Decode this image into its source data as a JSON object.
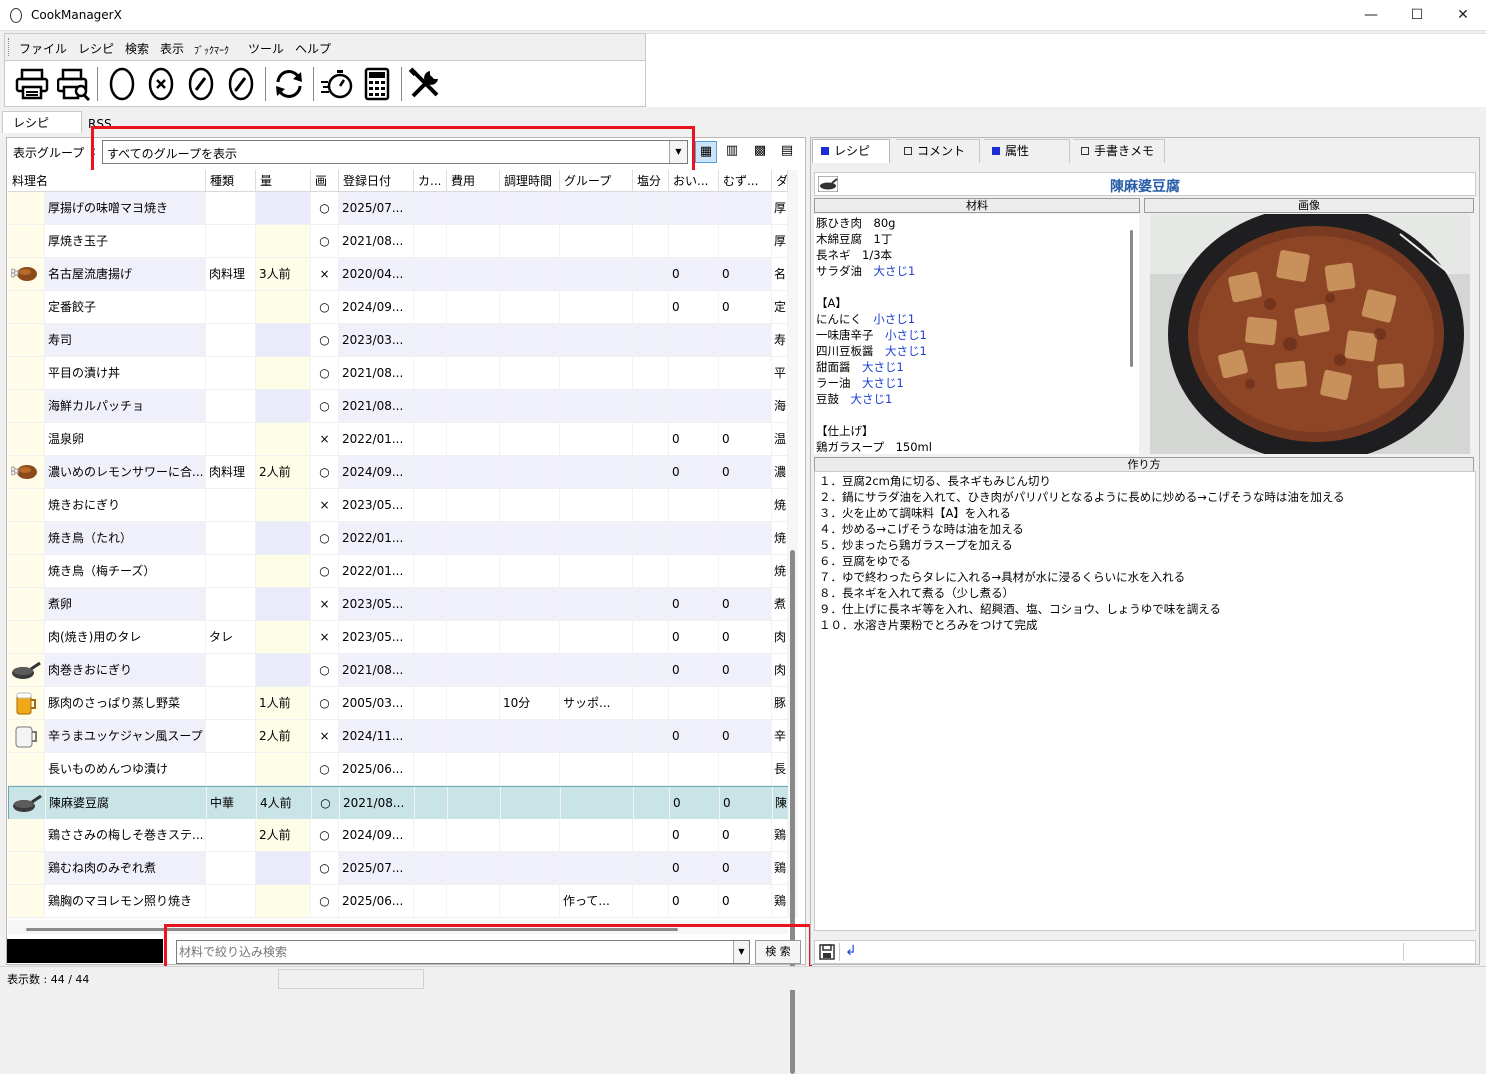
{
  "window": {
    "title": "CookManagerX",
    "minimize": "—",
    "maximize": "☐",
    "close": "✕"
  },
  "menu": [
    "ファイル",
    "レシピ",
    "検索",
    "表示",
    "ﾌﾞｯｸﾏｰｸ",
    "ツール",
    "ヘルプ"
  ],
  "toolbar": [
    "print-icon",
    "print-preview-icon",
    "new-recipe-icon",
    "delete-recipe-icon",
    "edit-recipe-icon",
    "edit-alt-icon",
    "refresh-icon",
    "timer-icon",
    "calculator-icon",
    "tools-icon"
  ],
  "pane_tabs": [
    "レシピ",
    "RSS"
  ],
  "group": {
    "label": "表示グループ",
    "value": "すべてのグループを表示"
  },
  "columns": [
    "料理名",
    "種類",
    "量",
    "画",
    "登録日付",
    "カ...",
    "費用",
    "調理時間",
    "グループ",
    "塩分",
    "おい...",
    "むず...",
    "ダ"
  ],
  "rows": [
    {
      "icon": "",
      "name": "厚揚げの味噌マヨ焼き",
      "cat": "",
      "amt": "",
      "img": "○",
      "date": "2025/07...",
      "time": "",
      "group": "",
      "o": "",
      "m": "",
      "f": "厚"
    },
    {
      "icon": "",
      "name": "厚焼き玉子",
      "cat": "",
      "amt": "",
      "img": "○",
      "date": "2021/08...",
      "time": "",
      "group": "",
      "o": "",
      "m": "",
      "f": "厚"
    },
    {
      "icon": "chicken-leg-icon",
      "name": "名古屋流唐揚げ",
      "cat": "肉料理",
      "amt": "3人前",
      "img": "×",
      "date": "2020/04...",
      "time": "",
      "group": "",
      "o": "0",
      "m": "0",
      "f": "名"
    },
    {
      "icon": "",
      "name": "定番餃子",
      "cat": "",
      "amt": "",
      "img": "○",
      "date": "2024/09...",
      "time": "",
      "group": "",
      "o": "0",
      "m": "0",
      "f": "定"
    },
    {
      "icon": "",
      "name": "寿司",
      "cat": "",
      "amt": "",
      "img": "○",
      "date": "2023/03...",
      "time": "",
      "group": "",
      "o": "",
      "m": "",
      "f": "寿"
    },
    {
      "icon": "",
      "name": "平目の漬け丼",
      "cat": "",
      "amt": "",
      "img": "○",
      "date": "2021/08...",
      "time": "",
      "group": "",
      "o": "",
      "m": "",
      "f": "平"
    },
    {
      "icon": "",
      "name": "海鮮カルパッチョ",
      "cat": "",
      "amt": "",
      "img": "○",
      "date": "2021/08...",
      "time": "",
      "group": "",
      "o": "",
      "m": "",
      "f": "海"
    },
    {
      "icon": "",
      "name": "温泉卵",
      "cat": "",
      "amt": "",
      "img": "×",
      "date": "2022/01...",
      "time": "",
      "group": "",
      "o": "0",
      "m": "0",
      "f": "温"
    },
    {
      "icon": "chicken-leg-icon",
      "name": "濃いめのレモンサワーに合...",
      "cat": "肉料理",
      "amt": "2人前",
      "img": "○",
      "date": "2024/09...",
      "time": "",
      "group": "",
      "o": "0",
      "m": "0",
      "f": "濃"
    },
    {
      "icon": "",
      "name": "焼きおにぎり",
      "cat": "",
      "amt": "",
      "img": "×",
      "date": "2023/05...",
      "time": "",
      "group": "",
      "o": "",
      "m": "",
      "f": "焼"
    },
    {
      "icon": "",
      "name": "焼き鳥（たれ）",
      "cat": "",
      "amt": "",
      "img": "○",
      "date": "2022/01...",
      "time": "",
      "group": "",
      "o": "",
      "m": "",
      "f": "焼"
    },
    {
      "icon": "",
      "name": "焼き鳥（梅チーズ）",
      "cat": "",
      "amt": "",
      "img": "○",
      "date": "2022/01...",
      "time": "",
      "group": "",
      "o": "",
      "m": "",
      "f": "焼"
    },
    {
      "icon": "",
      "name": "煮卵",
      "cat": "",
      "amt": "",
      "img": "×",
      "date": "2023/05...",
      "time": "",
      "group": "",
      "o": "0",
      "m": "0",
      "f": "煮"
    },
    {
      "icon": "",
      "name": "肉(焼き)用のタレ",
      "cat": "タレ",
      "amt": "",
      "img": "×",
      "date": "2023/05...",
      "time": "",
      "group": "",
      "o": "0",
      "m": "0",
      "f": "肉"
    },
    {
      "icon": "frying-pan-icon",
      "name": "肉巻きおにぎり",
      "cat": "",
      "amt": "",
      "img": "○",
      "date": "2021/08...",
      "time": "",
      "group": "",
      "o": "0",
      "m": "0",
      "f": "肉"
    },
    {
      "icon": "beer-mug-icon",
      "name": "豚肉のさっぱり蒸し野菜",
      "cat": "",
      "amt": "1人前",
      "img": "○",
      "date": "2005/03...",
      "time": "10分",
      "group": "サッポ...",
      "o": "",
      "m": "",
      "f": "豚"
    },
    {
      "icon": "mug-icon",
      "name": "辛うまユッケジャン風スープ",
      "cat": "",
      "amt": "2人前",
      "img": "×",
      "date": "2024/11...",
      "time": "",
      "group": "",
      "o": "0",
      "m": "0",
      "f": "辛"
    },
    {
      "icon": "",
      "name": "長いものめんつゆ漬け",
      "cat": "",
      "amt": "",
      "img": "○",
      "date": "2025/06...",
      "time": "",
      "group": "",
      "o": "",
      "m": "",
      "f": "長"
    },
    {
      "icon": "frying-pan-icon",
      "name": "陳麻婆豆腐",
      "cat": "中華",
      "amt": "4人前",
      "img": "○",
      "date": "2021/08...",
      "time": "",
      "group": "",
      "o": "0",
      "m": "0",
      "f": "陳",
      "selected": true
    },
    {
      "icon": "",
      "name": "鶏ささみの梅しそ巻きステ...",
      "cat": "",
      "amt": "2人前",
      "img": "○",
      "date": "2024/09...",
      "time": "",
      "group": "",
      "o": "0",
      "m": "0",
      "f": "鶏"
    },
    {
      "icon": "",
      "name": "鶏むね肉のみぞれ煮",
      "cat": "",
      "amt": "",
      "img": "○",
      "date": "2025/07...",
      "time": "",
      "group": "",
      "o": "0",
      "m": "0",
      "f": "鶏"
    },
    {
      "icon": "",
      "name": "鶏胸のマヨレモン照り焼き",
      "cat": "",
      "amt": "",
      "img": "○",
      "date": "2025/06...",
      "time": "",
      "group": "作って...",
      "o": "0",
      "m": "0",
      "f": "鶏"
    }
  ],
  "search": {
    "placeholder": "材料で絞り込み検索",
    "button": "検 索"
  },
  "status": {
    "count": "表示数 : 44 / 44"
  },
  "right_tabs": [
    "レシピ",
    "コメント",
    "属性",
    "手書きメモ"
  ],
  "recipe": {
    "title": "陳麻婆豆腐",
    "ingredients_header": "材料",
    "image_header": "画像",
    "method_header": "作り方",
    "ingredients": [
      {
        "name": "豚ひき肉　80g",
        "qty": ""
      },
      {
        "name": "木綿豆腐　1丁",
        "qty": ""
      },
      {
        "name": "長ネギ　1/3本",
        "qty": ""
      },
      {
        "name": "サラダ油　",
        "qty": "大さじ1"
      },
      {
        "name": "",
        "qty": ""
      },
      {
        "name": "【A】",
        "qty": ""
      },
      {
        "name": "にんにく　",
        "qty": "小さじ1"
      },
      {
        "name": "一味唐辛子　",
        "qty": "小さじ1"
      },
      {
        "name": "四川豆板醤　",
        "qty": "大さじ1"
      },
      {
        "name": "甜面醤　",
        "qty": "大さじ1"
      },
      {
        "name": "ラー油　",
        "qty": "大さじ1"
      },
      {
        "name": "豆鼓　",
        "qty": "大さじ1"
      },
      {
        "name": "",
        "qty": ""
      },
      {
        "name": "【仕上げ】",
        "qty": ""
      },
      {
        "name": "鶏ガラスープ　150ml",
        "qty": ""
      }
    ],
    "steps": [
      "１．豆腐2cm角に切る、長ネギもみじん切り",
      "２．鍋にサラダ油を入れて、ひき肉がパリパリとなるように長めに炒める→こげそうな時は油を加える",
      "３．火を止めて調味料【A】を入れる",
      "４．炒める→こげそうな時は油を加える",
      "５．炒まったら鶏ガラスープを加える",
      "６．豆腐をゆでる",
      "７．ゆで終わったらタレに入れる→具材が水に浸るくらいに水を入れる",
      "８．長ネギを入れて煮る（少し煮る）",
      "９．仕上げに長ネギ等を入れ、紹興酒、塩、コショウ、しょうゆで味を調える",
      "１０．水溶き片栗粉でとろみをつけて完成"
    ]
  },
  "colors": {
    "highlight_box": "#e8141e",
    "title_blue": "#2a5fa8",
    "qty_blue": "#1a3fd0",
    "selected_row": "#c9e4e6"
  }
}
